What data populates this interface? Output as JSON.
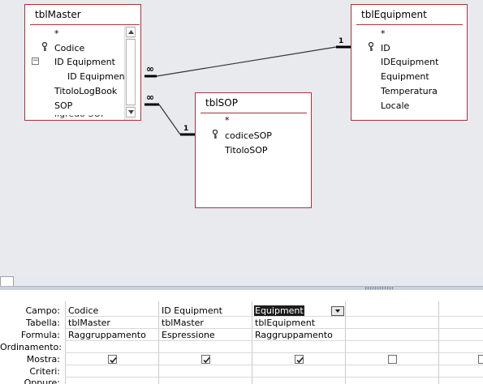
{
  "tables": {
    "tblMaster": {
      "title": "tblMaster",
      "fields": [
        "*",
        "Codice",
        "ID Equipment",
        "ID Equipment",
        "TitoloLogBook",
        "SOP"
      ],
      "clipped_field": "...(partial)"
    },
    "tblEquipment": {
      "title": "tblEquipment",
      "fields": [
        "*",
        "ID",
        "IDEquipment",
        "Equipment",
        "Temperatura",
        "Locale"
      ]
    },
    "tblSOP": {
      "title": "tblSOP",
      "fields": [
        "*",
        "codiceSOP",
        "TitoloSOP"
      ]
    }
  },
  "relations": [
    {
      "from_symbol": "∞",
      "to_symbol": "1"
    },
    {
      "from_symbol": "∞",
      "to_symbol": "1"
    }
  ],
  "grid": {
    "row_labels": [
      "Campo:",
      "Tabella:",
      "Formula:",
      "Ordinamento:",
      "Mostra:",
      "Criteri:",
      "Oppure:"
    ],
    "columns": [
      {
        "campo": "Codice",
        "tabella": "tblMaster",
        "formula": "Raggruppamento",
        "mostra": true
      },
      {
        "campo": "ID Equipment",
        "tabella": "tblMaster",
        "formula": "Espressione",
        "mostra": true
      },
      {
        "campo": "Equipment",
        "tabella": "tblEquipment",
        "formula": "Raggruppamento",
        "mostra": true
      },
      {
        "campo": "",
        "tabella": "",
        "formula": "",
        "mostra": false
      },
      {
        "campo": "",
        "tabella": "",
        "formula": "",
        "mostra": false
      }
    ]
  },
  "colors": {
    "relation_border": "#a1363b",
    "canvas_bg": "#e9eaee",
    "selection_bg": "#1c1c1c"
  }
}
